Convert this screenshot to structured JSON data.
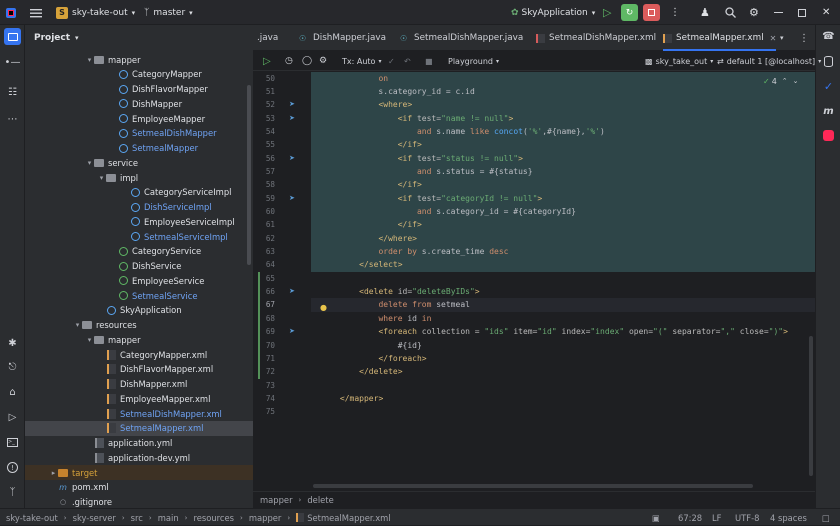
{
  "titlebar": {
    "project_badge": "S",
    "project": "sky-take-out",
    "branch": "master",
    "run_config": "SkyApplication"
  },
  "project_panel": {
    "title": "Project",
    "tree": [
      {
        "label": "mapper",
        "indent": 5,
        "icon": "folder",
        "arrow": "down"
      },
      {
        "label": "CategoryMapper",
        "indent": 7,
        "icon": "javaf",
        "arrow": ""
      },
      {
        "label": "DishFlavorMapper",
        "indent": 7,
        "icon": "javaf",
        "arrow": ""
      },
      {
        "label": "DishMapper",
        "indent": 7,
        "icon": "javaf",
        "arrow": ""
      },
      {
        "label": "EmployeeMapper",
        "indent": 7,
        "icon": "javaf",
        "arrow": ""
      },
      {
        "label": "SetmealDishMapper",
        "indent": 7,
        "icon": "javaf",
        "arrow": "",
        "blue": true
      },
      {
        "label": "SetmealMapper",
        "indent": 7,
        "icon": "javaf",
        "arrow": "",
        "blue": true
      },
      {
        "label": "service",
        "indent": 5,
        "icon": "folder",
        "arrow": "down"
      },
      {
        "label": "impl",
        "indent": 6,
        "icon": "folder",
        "arrow": "down"
      },
      {
        "label": "CategoryServiceImpl",
        "indent": 8,
        "icon": "javaf",
        "arrow": ""
      },
      {
        "label": "DishServiceImpl",
        "indent": 8,
        "icon": "javaf",
        "arrow": "",
        "blue": true
      },
      {
        "label": "EmployeeServiceImpl",
        "indent": 8,
        "icon": "javaf",
        "arrow": ""
      },
      {
        "label": "SetmealServiceImpl",
        "indent": 8,
        "icon": "javaf",
        "arrow": "",
        "blue": true
      },
      {
        "label": "CategoryService",
        "indent": 7,
        "icon": "javag",
        "arrow": ""
      },
      {
        "label": "DishService",
        "indent": 7,
        "icon": "javag",
        "arrow": ""
      },
      {
        "label": "EmployeeService",
        "indent": 7,
        "icon": "javag",
        "arrow": ""
      },
      {
        "label": "SetmealService",
        "indent": 7,
        "icon": "javag",
        "arrow": "",
        "blue": true
      },
      {
        "label": "SkyApplication",
        "indent": 6,
        "icon": "javaf",
        "arrow": ""
      },
      {
        "label": "resources",
        "indent": 4,
        "icon": "folder",
        "arrow": "down"
      },
      {
        "label": "mapper",
        "indent": 5,
        "icon": "folder",
        "arrow": "down"
      },
      {
        "label": "CategoryMapper.xml",
        "indent": 6,
        "icon": "xml",
        "arrow": ""
      },
      {
        "label": "DishFlavorMapper.xml",
        "indent": 6,
        "icon": "xml",
        "arrow": ""
      },
      {
        "label": "DishMapper.xml",
        "indent": 6,
        "icon": "xml",
        "arrow": ""
      },
      {
        "label": "EmployeeMapper.xml",
        "indent": 6,
        "icon": "xml",
        "arrow": ""
      },
      {
        "label": "SetmealDishMapper.xml",
        "indent": 6,
        "icon": "xml",
        "arrow": "",
        "blue": true
      },
      {
        "label": "SetmealMapper.xml",
        "indent": 6,
        "icon": "xml",
        "arrow": "",
        "blue": true,
        "selected": true
      },
      {
        "label": "application.yml",
        "indent": 5,
        "icon": "yml",
        "arrow": ""
      },
      {
        "label": "application-dev.yml",
        "indent": 5,
        "icon": "yml",
        "arrow": ""
      },
      {
        "label": "target",
        "indent": 2,
        "icon": "folder-orange",
        "arrow": "right",
        "target": true
      },
      {
        "label": "pom.xml",
        "indent": 2,
        "icon": "pom",
        "arrow": ""
      },
      {
        "label": ".gitignore",
        "indent": 2,
        "icon": "txt",
        "arrow": ""
      }
    ]
  },
  "tabs": [
    {
      "label": ".java",
      "type": "java"
    },
    {
      "label": "DishMapper.java",
      "type": "java"
    },
    {
      "label": "SetmealDishMapper.java",
      "type": "java"
    },
    {
      "label": "SetmealDishMapper.xml",
      "type": "xml"
    },
    {
      "label": "SetmealMapper.xml",
      "type": "xml",
      "active": true
    }
  ],
  "toolbar": {
    "tx": "Tx: Auto",
    "playground": "Playground",
    "datasource": "sky_take_out",
    "session": "default 1 [@localhost]",
    "warnings": "4"
  },
  "editor": {
    "lines": [
      {
        "n": "50",
        "hl": true,
        "code": [
          [
            "              ",
            "pl"
          ],
          [
            "on",
            "kw"
          ]
        ]
      },
      {
        "n": "51",
        "hl": true,
        "code": [
          [
            "              s.category_id = c.id",
            "pl"
          ]
        ]
      },
      {
        "n": "52",
        "hl": true,
        "code": [
          [
            "              ",
            "pl"
          ],
          [
            "<where>",
            "tg"
          ]
        ]
      },
      {
        "n": "53",
        "hl": true,
        "code": [
          [
            "                  ",
            "pl"
          ],
          [
            "<if ",
            "tg"
          ],
          [
            "test=",
            "at"
          ],
          [
            "\"name != null\"",
            "st"
          ],
          [
            ">",
            "tg"
          ]
        ]
      },
      {
        "n": "54",
        "hl": true,
        "code": [
          [
            "                      ",
            "pl"
          ],
          [
            "and ",
            "kw"
          ],
          [
            "s.name ",
            "pl"
          ],
          [
            "like ",
            "kw"
          ],
          [
            "concot",
            "fn"
          ],
          [
            "(",
            "pl"
          ],
          [
            "'%'",
            "st"
          ],
          [
            ",#{name},",
            "pl"
          ],
          [
            "'%'",
            "st"
          ],
          [
            ")",
            "pl"
          ]
        ]
      },
      {
        "n": "55",
        "hl": true,
        "code": [
          [
            "                  ",
            "pl"
          ],
          [
            "</if>",
            "tg"
          ]
        ]
      },
      {
        "n": "56",
        "hl": true,
        "code": [
          [
            "                  ",
            "pl"
          ],
          [
            "<if ",
            "tg"
          ],
          [
            "test=",
            "at"
          ],
          [
            "\"status != null\"",
            "st"
          ],
          [
            ">",
            "tg"
          ]
        ]
      },
      {
        "n": "57",
        "hl": true,
        "code": [
          [
            "                      ",
            "pl"
          ],
          [
            "and ",
            "kw"
          ],
          [
            "s.status = #{status}",
            "pl"
          ]
        ]
      },
      {
        "n": "58",
        "hl": true,
        "code": [
          [
            "                  ",
            "pl"
          ],
          [
            "</if>",
            "tg"
          ]
        ]
      },
      {
        "n": "59",
        "hl": true,
        "code": [
          [
            "                  ",
            "pl"
          ],
          [
            "<if ",
            "tg"
          ],
          [
            "test=",
            "at"
          ],
          [
            "\"categoryId != null\"",
            "st"
          ],
          [
            ">",
            "tg"
          ]
        ]
      },
      {
        "n": "60",
        "hl": true,
        "code": [
          [
            "                      ",
            "pl"
          ],
          [
            "and ",
            "kw"
          ],
          [
            "s.category_id = #{categoryId}",
            "pl"
          ]
        ]
      },
      {
        "n": "61",
        "hl": true,
        "code": [
          [
            "                  ",
            "pl"
          ],
          [
            "</if>",
            "tg"
          ]
        ]
      },
      {
        "n": "62",
        "hl": true,
        "code": [
          [
            "              ",
            "pl"
          ],
          [
            "</where>",
            "tg"
          ]
        ]
      },
      {
        "n": "63",
        "hl": true,
        "code": [
          [
            "              ",
            "pl"
          ],
          [
            "order by ",
            "kw"
          ],
          [
            "s.create_time ",
            "pl"
          ],
          [
            "desc",
            "kw"
          ]
        ]
      },
      {
        "n": "64",
        "hl": true,
        "code": [
          [
            "          ",
            "pl"
          ],
          [
            "</select>",
            "tg"
          ]
        ]
      },
      {
        "n": "65",
        "code": [
          [
            "",
            "pl"
          ]
        ]
      },
      {
        "n": "66",
        "code": [
          [
            "          ",
            "pl"
          ],
          [
            "<delete ",
            "tg"
          ],
          [
            "id=",
            "at"
          ],
          [
            "\"deleteByIDs\"",
            "st"
          ],
          [
            ">",
            "tg"
          ]
        ]
      },
      {
        "n": "67",
        "cur": true,
        "code": [
          [
            "              ",
            "pl"
          ],
          [
            "delete from ",
            "kw"
          ],
          [
            "setmeal",
            "pl"
          ]
        ]
      },
      {
        "n": "68",
        "code": [
          [
            "              ",
            "pl"
          ],
          [
            "where ",
            "kw"
          ],
          [
            "id ",
            "pl"
          ],
          [
            "in",
            "kw"
          ]
        ]
      },
      {
        "n": "69",
        "code": [
          [
            "              ",
            "pl"
          ],
          [
            "<foreach ",
            "tg"
          ],
          [
            "collection = ",
            "at"
          ],
          [
            "\"ids\" ",
            "st"
          ],
          [
            "item=",
            "at"
          ],
          [
            "\"id\" ",
            "st"
          ],
          [
            "index=",
            "at"
          ],
          [
            "\"index\" ",
            "st"
          ],
          [
            "open=",
            "at"
          ],
          [
            "\"(\" ",
            "st"
          ],
          [
            "separator=",
            "at"
          ],
          [
            "\",\" ",
            "st"
          ],
          [
            "close=",
            "at"
          ],
          [
            "\")\"",
            "st"
          ],
          [
            ">",
            "tg"
          ]
        ]
      },
      {
        "n": "70",
        "code": [
          [
            "                  #{id}",
            "pl"
          ]
        ]
      },
      {
        "n": "71",
        "code": [
          [
            "              ",
            "pl"
          ],
          [
            "</foreach>",
            "tg"
          ]
        ]
      },
      {
        "n": "72",
        "code": [
          [
            "          ",
            "pl"
          ],
          [
            "</delete>",
            "tg"
          ]
        ]
      },
      {
        "n": "73",
        "code": [
          [
            "",
            "pl"
          ]
        ]
      },
      {
        "n": "74",
        "code": [
          [
            "      ",
            "pl"
          ],
          [
            "</mapper>",
            "tg"
          ]
        ]
      },
      {
        "n": "75",
        "code": [
          [
            "",
            "pl"
          ]
        ]
      }
    ],
    "breadcrumb": [
      "mapper",
      "delete"
    ]
  },
  "statusbar": {
    "path": [
      "sky-take-out",
      "sky-server",
      "src",
      "main",
      "resources",
      "mapper",
      "SetmealMapper.xml"
    ],
    "position": "67:28",
    "line_sep": "LF",
    "encoding": "UTF-8",
    "indent": "4 spaces"
  }
}
